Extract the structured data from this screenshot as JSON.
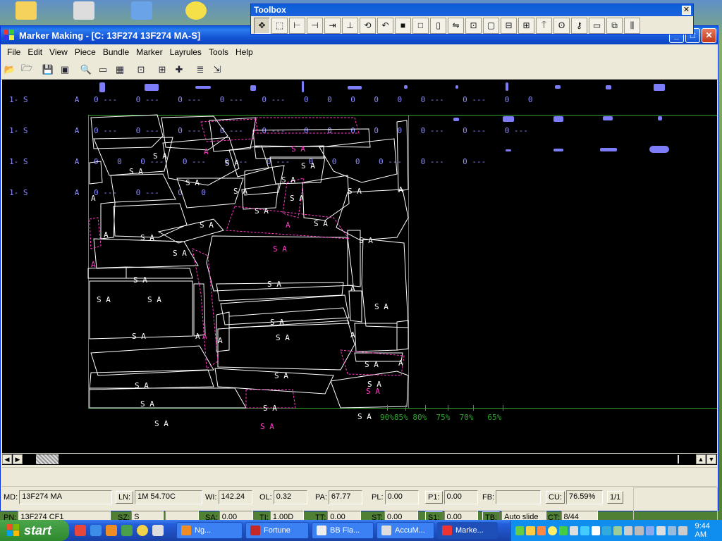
{
  "window": {
    "title": "Marker Making - [C:  13F274   13F274 MA-S]",
    "controls": {
      "minimize": "_",
      "maximize": "□",
      "close": "✕"
    }
  },
  "menu": [
    "File",
    "Edit",
    "View",
    "Piece",
    "Bundle",
    "Marker",
    "Layrules",
    "Tools",
    "Help"
  ],
  "toolbar": {
    "icons": [
      "open-folder-icon",
      "open-icon",
      "save-icon",
      "save-all-icon",
      "zoom-icon",
      "rectangle-icon",
      "grid-view-icon",
      "fit-icon",
      "add-piece-icon",
      "insert-icon",
      "notes-icon",
      "layout-icon"
    ]
  },
  "toolbox": {
    "title": "Toolbox",
    "close": "✕",
    "tools": [
      "move-icon",
      "select-box-icon",
      "align-left-icon",
      "align-right-icon",
      "push-icon",
      "align-bottom-icon",
      "rotate-icon",
      "rotate-45-icon",
      "fill-icon",
      "square-icon",
      "rectangle-edit-icon",
      "flip-icon",
      "fit-box-icon",
      "bound-box-icon",
      "frame-icon",
      "grid-icon",
      "pin-icon",
      "bulb-icon",
      "key-icon",
      "window-icon",
      "overlap-icon",
      "split-icon"
    ]
  },
  "marker": {
    "rows": [
      {
        "size": "1- S",
        "code": "A",
        "values": "0 ---    0 ---    0 ---    0 ---    0 ---    0    0    0    0    0    0 ---    0 ---    0    0"
      },
      {
        "size": "1- S",
        "code": "A",
        "values": "0 ---    0 ---    0 ---    0 ---    0 ---    0    0    0    0    0    0 ---    0 ---    0 ---"
      },
      {
        "size": "1- S",
        "code": "A",
        "values": "0    0    0 ---    0 ---    0 ---    0 ---    0    0    0    0 ---    0 ---    0 ---"
      },
      {
        "size": "1- S",
        "code": "A",
        "values": "0 ---    0 ---    0    0"
      }
    ],
    "piece_label": "S A",
    "utilization_scale": "90%85% 80%  75%  70%   65%"
  },
  "status": {
    "md_label": "MD:",
    "md": "13F274 MA",
    "ln_label": "LN:",
    "ln": "1M 54.70C",
    "wi_label": "WI:",
    "wi": "142.24",
    "ol_label": "OL:",
    "ol": "0.32",
    "pa_label": "PA:",
    "pa": "67.77",
    "pl_label": "PL:",
    "pl": "0.00",
    "p1_label": "P1:",
    "p1": "0.00",
    "fb_label": "FB:",
    "fb": "",
    "cu_label": "CU:",
    "cu": "76.59%",
    "page": "1/1",
    "pn_label": "PN:",
    "pn": "13F274 CF1",
    "sz_label": "SZ:",
    "sz": "S",
    "sz_extra": "",
    "sa_label": "SA:",
    "sa": "0.00",
    "ti_label": "TI:",
    "ti": "1.00D",
    "tt_label": "TT:",
    "tt": "0.00",
    "st_label": "ST:",
    "st": "0.00",
    "s1_label": "S1:",
    "s1": "0.00",
    "tb_label": "TB:",
    "tb": "Auto slide",
    "ct_label": "CT:",
    "ct": "8/44"
  },
  "taskbar": {
    "start": "start",
    "tasks": [
      "Ng...",
      "Fortune",
      "BB Fla...",
      "AccuM...",
      "Marke..."
    ],
    "clock": "9:44 AM"
  },
  "colors": {
    "canvas_bg": "#000000",
    "text_blue": "#8c8cff",
    "frame_green": "#2da52d",
    "piece_outline": "#ffffff",
    "piece_magenta": "#ff3cc8"
  }
}
